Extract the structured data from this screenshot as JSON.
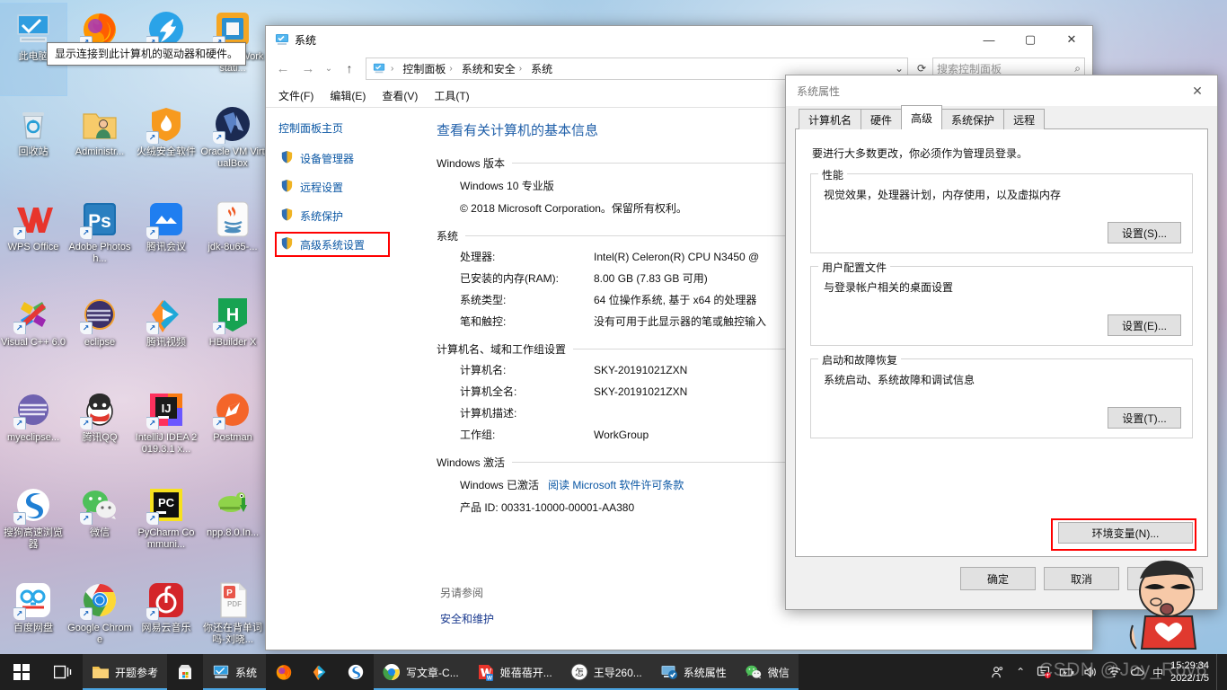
{
  "desktop": {
    "tooltip": "显示连接到此计算机的驱动器和硬件。",
    "icons": [
      {
        "label": "此电脑",
        "icon": "this-pc-icon",
        "selected": true,
        "shortcut": false
      },
      {
        "label": "Firefox",
        "icon": "firefox-icon",
        "selected": false,
        "shortcut": true
      },
      {
        "label": "钉钉",
        "icon": "dingtalk-icon",
        "selected": false,
        "shortcut": true
      },
      {
        "label": "VMware Workstati...",
        "icon": "vmware-icon",
        "selected": false,
        "shortcut": true
      },
      {
        "label": "回收站",
        "icon": "recycle-bin-icon",
        "selected": false,
        "shortcut": false
      },
      {
        "label": "Administr...",
        "icon": "user-folder-icon",
        "selected": false,
        "shortcut": false
      },
      {
        "label": "火绒安全软件",
        "icon": "huorong-icon",
        "selected": false,
        "shortcut": true
      },
      {
        "label": "Oracle VM VirtualBox",
        "icon": "virtualbox-icon",
        "selected": false,
        "shortcut": true
      },
      {
        "label": "WPS Office",
        "icon": "wps-office-icon",
        "selected": false,
        "shortcut": true
      },
      {
        "label": "Adobe Photosh...",
        "icon": "photoshop-icon",
        "selected": false,
        "shortcut": true
      },
      {
        "label": "腾讯会议",
        "icon": "tencent-meeting-icon",
        "selected": false,
        "shortcut": true
      },
      {
        "label": "jdk-8u65-...",
        "icon": "java-icon",
        "selected": false,
        "shortcut": false
      },
      {
        "label": "Visual C++ 6.0",
        "icon": "visual-cpp-icon",
        "selected": false,
        "shortcut": true
      },
      {
        "label": "eclipse",
        "icon": "eclipse-icon",
        "selected": false,
        "shortcut": true
      },
      {
        "label": "腾讯视频",
        "icon": "tencent-video-icon",
        "selected": false,
        "shortcut": true
      },
      {
        "label": "HBuilder X",
        "icon": "hbuilder-icon",
        "selected": false,
        "shortcut": true
      },
      {
        "label": "myeclipse...",
        "icon": "myeclipse-icon",
        "selected": false,
        "shortcut": true
      },
      {
        "label": "腾讯QQ",
        "icon": "qq-icon",
        "selected": false,
        "shortcut": true
      },
      {
        "label": "IntelliJ IDEA 2019.3.1 x...",
        "icon": "intellij-idea-icon",
        "selected": false,
        "shortcut": true
      },
      {
        "label": "Postman",
        "icon": "postman-icon",
        "selected": false,
        "shortcut": true
      },
      {
        "label": "搜狗高速浏览器",
        "icon": "sogou-browser-icon",
        "selected": false,
        "shortcut": true
      },
      {
        "label": "微信",
        "icon": "wechat-icon",
        "selected": false,
        "shortcut": true
      },
      {
        "label": "PyCharm Communi...",
        "icon": "pycharm-icon",
        "selected": false,
        "shortcut": true
      },
      {
        "label": "npp.8.0.In...",
        "icon": "notepadpp-icon",
        "selected": false,
        "shortcut": false
      },
      {
        "label": "百度网盘",
        "icon": "baidu-netdisk-icon",
        "selected": false,
        "shortcut": true
      },
      {
        "label": "Google Chrome",
        "icon": "chrome-icon",
        "selected": false,
        "shortcut": true
      },
      {
        "label": "网易云音乐",
        "icon": "netease-music-icon",
        "selected": false,
        "shortcut": true
      },
      {
        "label": "你还在背单词吗-刘晓...",
        "icon": "pdf-file-icon",
        "selected": false,
        "shortcut": false
      }
    ]
  },
  "control_panel": {
    "title": "系统",
    "window_buttons": {
      "minimize": "—",
      "maximize": "▢",
      "close": "✕"
    },
    "breadcrumb": [
      "控制面板",
      "系统和安全",
      "系统"
    ],
    "search_placeholder": "搜索控制面板",
    "menu": [
      "文件(F)",
      "编辑(E)",
      "查看(V)",
      "工具(T)"
    ],
    "sidebar": {
      "home": "控制面板主页",
      "items": [
        {
          "label": "设备管理器",
          "highlighted": false
        },
        {
          "label": "远程设置",
          "highlighted": false
        },
        {
          "label": "系统保护",
          "highlighted": false
        },
        {
          "label": "高级系统设置",
          "highlighted": true
        }
      ]
    },
    "main": {
      "heading": "查看有关计算机的基本信息",
      "sections": [
        {
          "title": "Windows 版本",
          "lines": [
            "Windows 10 专业版",
            "© 2018 Microsoft Corporation。保留所有权利。"
          ]
        },
        {
          "title": "系统",
          "rows": [
            {
              "k": "处理器:",
              "v": "Intel(R) Celeron(R) CPU N3450 @"
            },
            {
              "k": "已安装的内存(RAM):",
              "v": "8.00 GB (7.83 GB 可用)"
            },
            {
              "k": "系统类型:",
              "v": "64 位操作系统, 基于 x64 的处理器"
            },
            {
              "k": "笔和触控:",
              "v": "没有可用于此显示器的笔或触控输入"
            }
          ]
        },
        {
          "title": "计算机名、域和工作组设置",
          "rows": [
            {
              "k": "计算机名:",
              "v": "SKY-20191021ZXN"
            },
            {
              "k": "计算机全名:",
              "v": "SKY-20191021ZXN"
            },
            {
              "k": "计算机描述:",
              "v": ""
            },
            {
              "k": "工作组:",
              "v": "WorkGroup"
            }
          ]
        },
        {
          "title": "Windows 激活",
          "activation_status": "Windows 已激活",
          "activation_link": "阅读 Microsoft 软件许可条款",
          "product_id": "产品 ID: 00331-10000-00001-AA380"
        }
      ],
      "see_also_heading": "另请参阅",
      "see_also_link": "安全和维护"
    }
  },
  "system_properties": {
    "title": "系统属性",
    "close": "✕",
    "tabs": [
      {
        "label": "计算机名",
        "active": false
      },
      {
        "label": "硬件",
        "active": false
      },
      {
        "label": "高级",
        "active": true
      },
      {
        "label": "系统保护",
        "active": false
      },
      {
        "label": "远程",
        "active": false
      }
    ],
    "intro": "要进行大多数更改，你必须作为管理员登录。",
    "groups": [
      {
        "legend": "性能",
        "desc": "视觉效果，处理器计划，内存使用，以及虚拟内存",
        "button": "设置(S)..."
      },
      {
        "legend": "用户配置文件",
        "desc": "与登录帐户相关的桌面设置",
        "button": "设置(E)..."
      },
      {
        "legend": "启动和故障恢复",
        "desc": "系统启动、系统故障和调试信息",
        "button": "设置(T)..."
      }
    ],
    "env_button": {
      "label": "环境变量(N)...",
      "highlighted": true
    },
    "footer_buttons": [
      {
        "label": "确定"
      },
      {
        "label": "取消"
      },
      {
        "label": "应用(A)"
      }
    ]
  },
  "taskbar": {
    "start": "start-icon",
    "task_view": "task-view-icon",
    "items": [
      {
        "label": "开题参考",
        "icon": "folder-icon",
        "open": true
      },
      {
        "label": "",
        "icon": "microsoft-store-icon",
        "open": false
      },
      {
        "label": "系统",
        "icon": "this-pc-icon",
        "open": true
      },
      {
        "label": "",
        "icon": "firefox-icon",
        "open": false
      },
      {
        "label": "",
        "icon": "tencent-video-icon",
        "open": false
      },
      {
        "label": "",
        "icon": "sogou-browser-icon",
        "open": false
      },
      {
        "label": "写文章-C...",
        "icon": "browser-tab-icon",
        "open": true
      },
      {
        "label": "姬蓓蓓开...",
        "icon": "wps-writer-icon",
        "open": true
      },
      {
        "label": "王导260...",
        "icon": "circle-avatar-icon",
        "open": true
      },
      {
        "label": "系统属性",
        "icon": "system-properties-icon",
        "open": true
      },
      {
        "label": "微信",
        "icon": "wechat-icon",
        "open": true
      }
    ],
    "tray": [
      {
        "icon": "people-icon"
      },
      {
        "icon": "chevron-up-icon"
      },
      {
        "icon": "security-alert-icon"
      },
      {
        "icon": "battery-icon"
      },
      {
        "icon": "volume-icon"
      },
      {
        "icon": "wifi-icon"
      },
      {
        "icon": "onedrive-icon"
      },
      {
        "icon": "ime-chinese-icon"
      }
    ],
    "ime_label": "中",
    "clock_time": "15:29:34",
    "clock_date": "2022/1/5"
  },
  "watermark": "CSDN @Joy_Roy6"
}
